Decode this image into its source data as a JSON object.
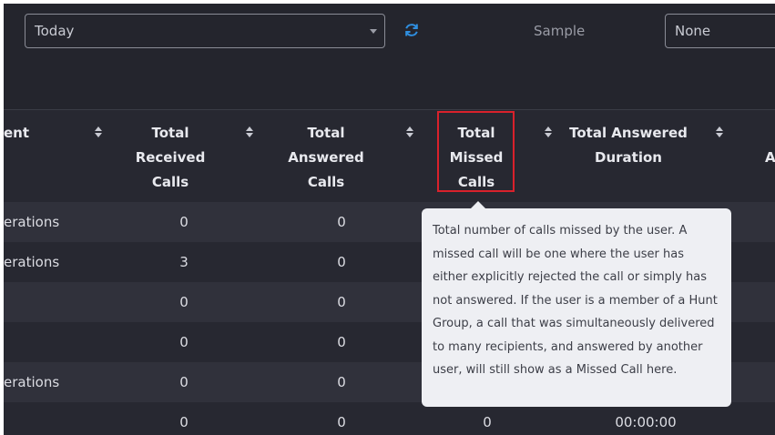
{
  "filters": {
    "period_value": "Today",
    "sample_label": "Sample",
    "sample_value": "None"
  },
  "table": {
    "columns": [
      {
        "label": "ent"
      },
      {
        "label": "Total Received Calls"
      },
      {
        "label": "Total Answered Calls"
      },
      {
        "label": "Total Missed Calls"
      },
      {
        "label": "Total Answered Duration"
      },
      {
        "label": "A"
      }
    ],
    "rows": [
      {
        "name": "erations",
        "received": "0",
        "answered": "0",
        "missed": "",
        "duration": ""
      },
      {
        "name": "erations",
        "received": "3",
        "answered": "0",
        "missed": "",
        "duration": ""
      },
      {
        "name": "",
        "received": "0",
        "answered": "0",
        "missed": "",
        "duration": ""
      },
      {
        "name": "",
        "received": "0",
        "answered": "0",
        "missed": "",
        "duration": ""
      },
      {
        "name": "erations",
        "received": "0",
        "answered": "0",
        "missed": "",
        "duration": ""
      },
      {
        "name": "",
        "received": "0",
        "answered": "0",
        "missed": "0",
        "duration": "00:00:00"
      }
    ]
  },
  "tooltip": {
    "text": "Total number of calls missed by the user. A missed call will be one where the user has either explicitly rejected the call or simply has not answered. If the user is a member of a Hunt Group, a call that was simultaneously delivered to many recipients, and answered by another user, will still show as a Missed Call here."
  },
  "colors": {
    "background": "#272831",
    "highlight": "#d9212b",
    "accent": "#2f8fe0"
  },
  "icons": [
    "chevron-down-icon",
    "refresh-icon",
    "sort-icon"
  ]
}
